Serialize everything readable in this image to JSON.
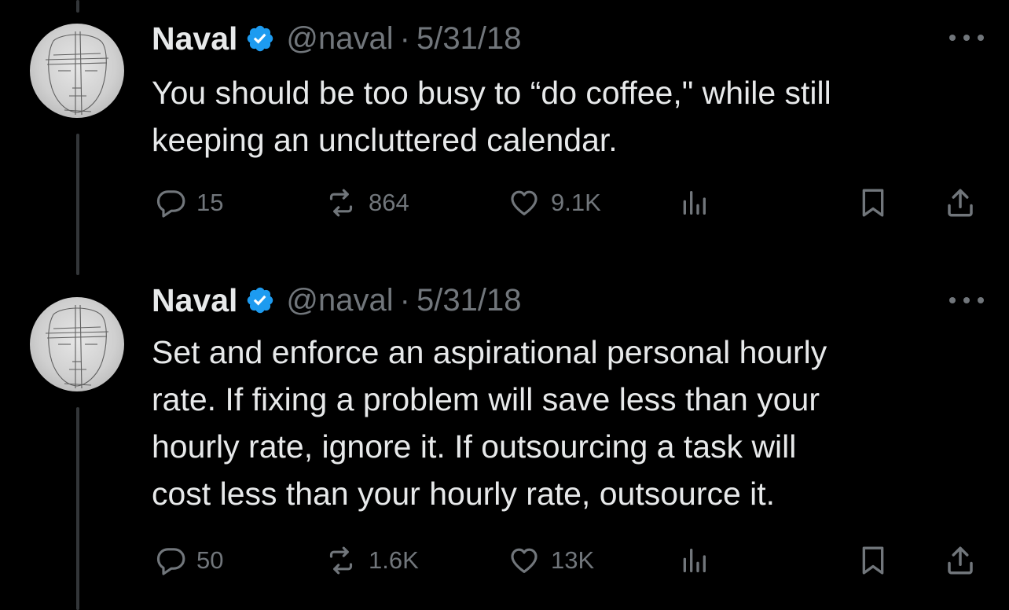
{
  "colors": {
    "background": "#000000",
    "primary_text": "#e7e9ea",
    "secondary_text": "#71767b",
    "verified_badge": "#1d9bf0",
    "thread_line": "#333639"
  },
  "tweets": [
    {
      "author_name": "Naval",
      "handle": "@naval",
      "separator": "·",
      "date": "5/31/18",
      "verified": true,
      "text": "You should be too busy to “do coffee,\" while still\nkeeping an uncluttered calendar.",
      "replies": "15",
      "reposts": "864",
      "likes": "9.1K",
      "icons": {
        "reply": "reply-icon",
        "repost": "repost-icon",
        "like": "like-icon",
        "views": "views-icon",
        "bookmark": "bookmark-icon",
        "share": "share-icon",
        "more": "more-icon"
      }
    },
    {
      "author_name": "Naval",
      "handle": "@naval",
      "separator": "·",
      "date": "5/31/18",
      "verified": true,
      "text": "Set and enforce an aspirational personal hourly\nrate. If fixing a problem will save less than your\nhourly rate, ignore it. If outsourcing a task will\ncost less than your hourly rate, outsource it.",
      "replies": "50",
      "reposts": "1.6K",
      "likes": "13K",
      "icons": {
        "reply": "reply-icon",
        "repost": "repost-icon",
        "like": "like-icon",
        "views": "views-icon",
        "bookmark": "bookmark-icon",
        "share": "share-icon",
        "more": "more-icon"
      }
    }
  ]
}
